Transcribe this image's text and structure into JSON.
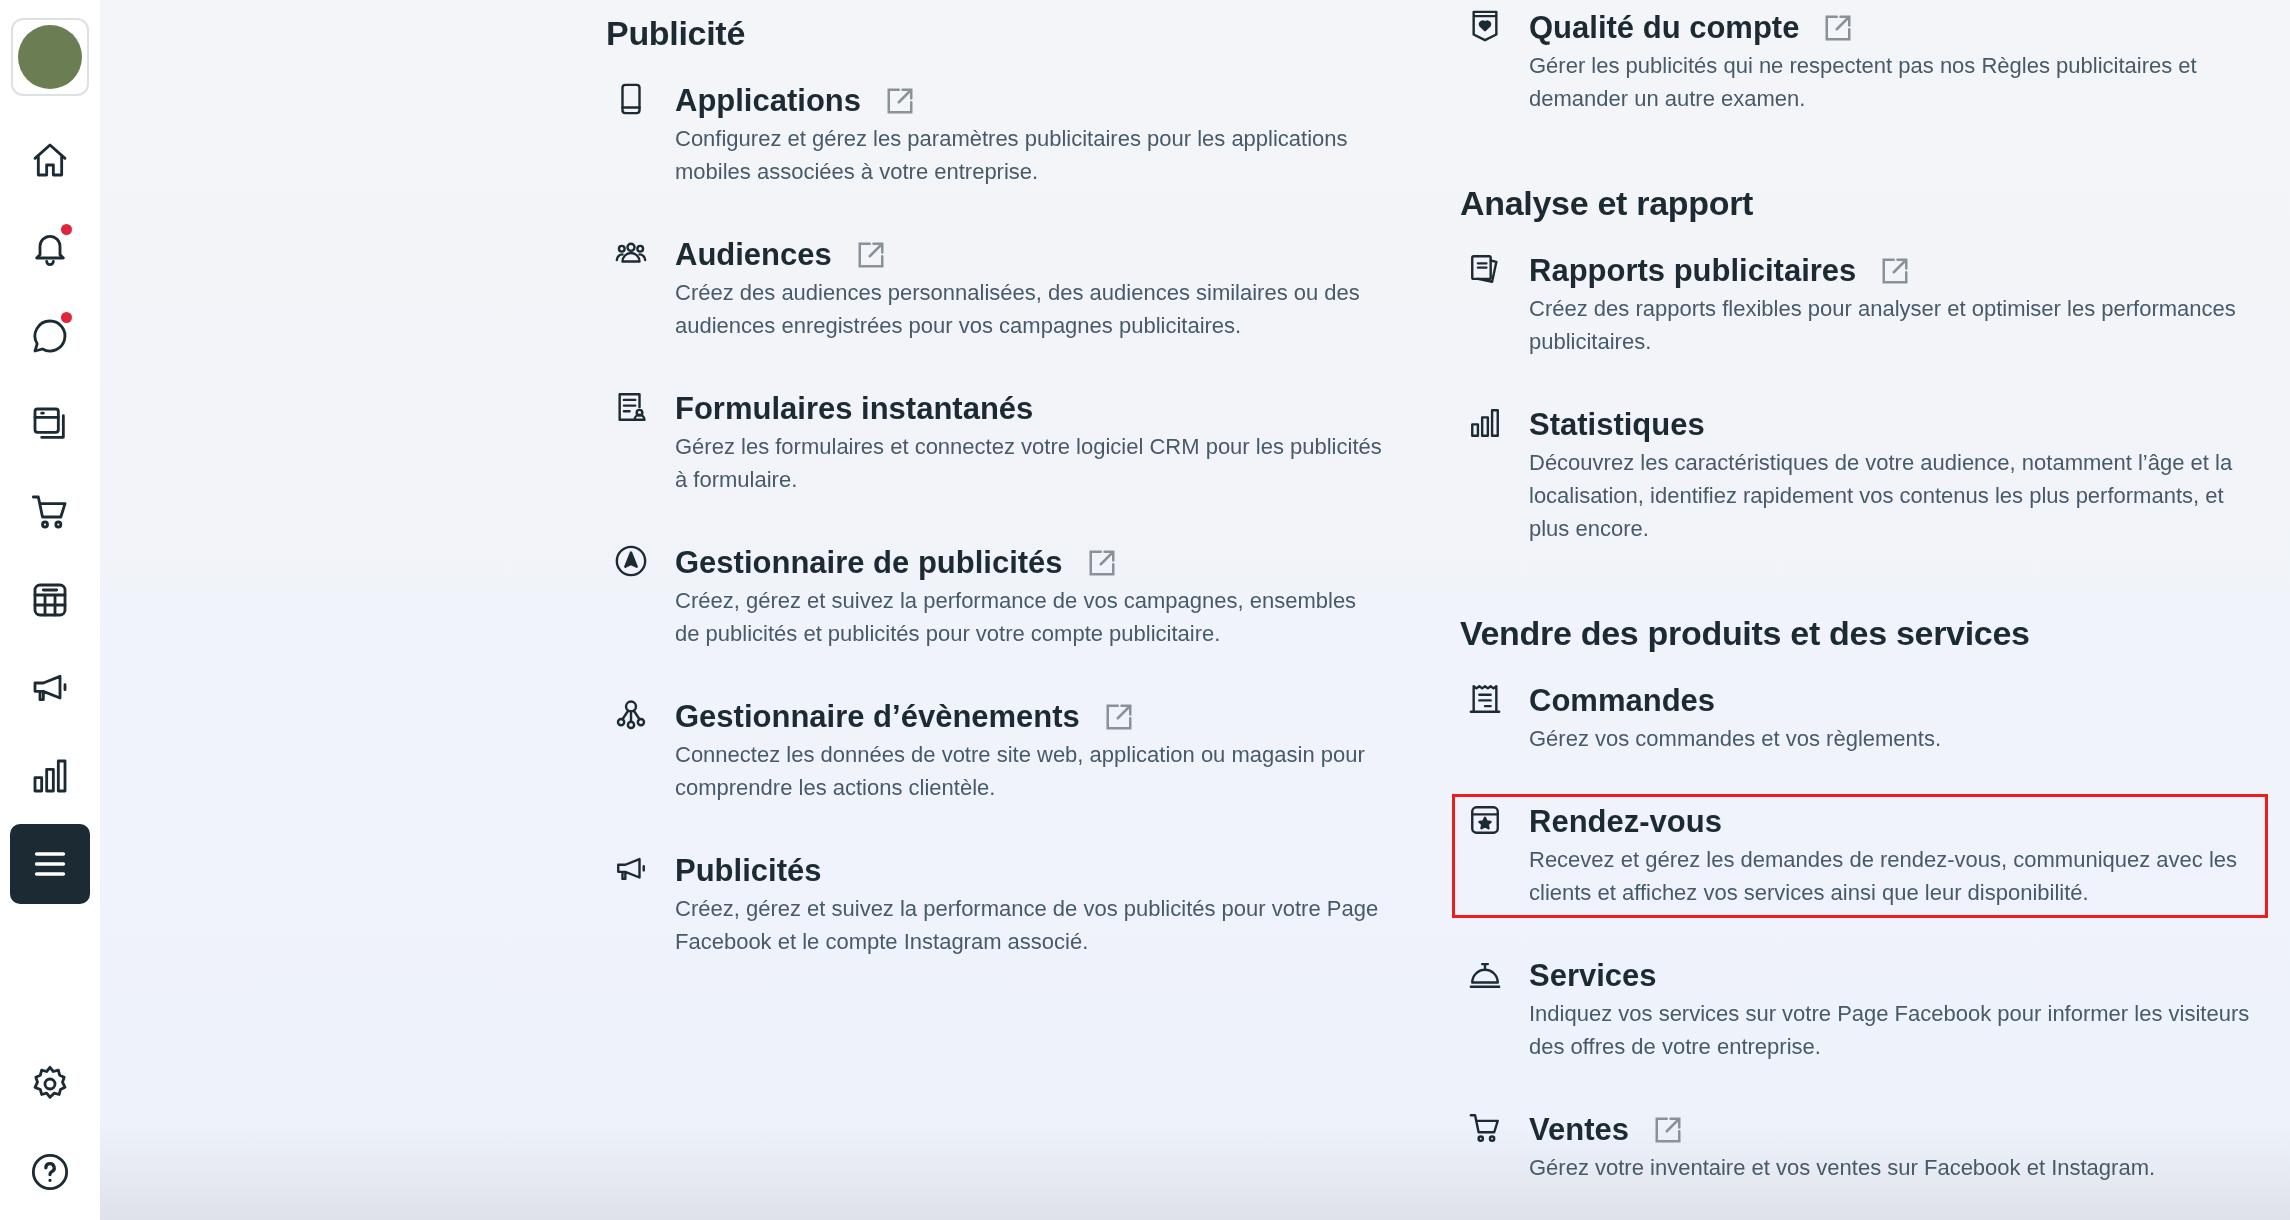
{
  "sidebar": {
    "avatar": true,
    "items": [
      {
        "kind": "home",
        "selected": false,
        "badge": false
      },
      {
        "kind": "bell",
        "selected": false,
        "badge": true
      },
      {
        "kind": "chat",
        "selected": false,
        "badge": true
      },
      {
        "kind": "pages",
        "selected": false,
        "badge": false
      },
      {
        "kind": "cart",
        "selected": false,
        "badge": false
      },
      {
        "kind": "table",
        "selected": false,
        "badge": false
      },
      {
        "kind": "megaphone",
        "selected": false,
        "badge": false
      },
      {
        "kind": "chart",
        "selected": false,
        "badge": false
      },
      {
        "kind": "menu",
        "selected": true,
        "badge": false
      }
    ],
    "bottom_items": [
      {
        "kind": "settings",
        "selected": false,
        "badge": false
      },
      {
        "kind": "help",
        "selected": false,
        "badge": false
      }
    ]
  },
  "columns": [
    {
      "sections": [
        {
          "heading": "Publicité",
          "items": [
            {
              "kind": "phone",
              "title": "Applications",
              "external": true,
              "highlighted": false,
              "description": "Configurez et gérez les paramètres publicitaires pour les applications mobiles associées à votre entreprise."
            },
            {
              "kind": "people",
              "title": "Audiences",
              "external": true,
              "highlighted": false,
              "description": "Créez des audiences personnalisées, des audiences similaires ou des audiences enregistrées pour vos campagnes publicitaires."
            },
            {
              "kind": "form",
              "title": "Formulaires instantanés",
              "external": false,
              "highlighted": false,
              "description": "Gérez les formulaires et connectez votre logiciel CRM pour les publicités à formulaire."
            },
            {
              "kind": "navigate",
              "title": "Gestionnaire de publicités",
              "external": true,
              "highlighted": false,
              "description": "Créez, gérez et suivez la performance de vos campagnes, ensembles de publicités et publicités pour votre compte publicitaire."
            },
            {
              "kind": "network",
              "title": "Gestionnaire d’évènements",
              "external": true,
              "highlighted": false,
              "description": "Connectez les données de votre site web, application ou magasin pour comprendre les actions clientèle."
            },
            {
              "kind": "megaphone",
              "title": "Publicités",
              "external": false,
              "highlighted": false,
              "description": "Créez, gérez et suivez la performance de vos publicités pour votre Page Facebook et le compte Instagram associé."
            }
          ]
        }
      ]
    },
    {
      "sections": [
        {
          "items": [
            {
              "kind": "shield",
              "title": "Qualité du compte",
              "external": true,
              "highlighted": false,
              "description": "Gérer les publicités qui ne respectent pas nos Règles publicitaires et demander un autre examen."
            }
          ]
        },
        {
          "heading": "Analyse et rapport",
          "items": [
            {
              "kind": "reports",
              "title": "Rapports publicitaires",
              "external": true,
              "highlighted": false,
              "description": "Créez des rapports flexibles pour analyser et optimiser les performances publicitaires."
            },
            {
              "kind": "chart",
              "title": "Statistiques",
              "external": false,
              "highlighted": false,
              "description": "Découvrez les caractéristiques de votre audience, notamment l’âge et la localisation, identifiez rapidement vos contenus les plus performants, et plus encore."
            }
          ]
        },
        {
          "heading": "Vendre des produits et des services",
          "items": [
            {
              "kind": "receipt",
              "title": "Commandes",
              "external": false,
              "highlighted": false,
              "description": "Gérez vos commandes et vos règlements."
            },
            {
              "kind": "calendar",
              "title": "Rendez-vous",
              "external": false,
              "highlighted": true,
              "description": "Recevez et gérez les demandes de rendez-vous, communiquez avec les clients et affichez vos services ainsi que leur disponibilité."
            },
            {
              "kind": "bell-desk",
              "title": "Services",
              "external": false,
              "highlighted": false,
              "description": "Indiquez vos services sur votre Page Facebook pour informer les visiteurs des offres de votre entreprise."
            },
            {
              "kind": "cart",
              "title": "Ventes",
              "external": true,
              "highlighted": false,
              "description": "Gérez votre inventaire et vos ventes sur Facebook et Instagram."
            }
          ]
        }
      ]
    }
  ]
}
